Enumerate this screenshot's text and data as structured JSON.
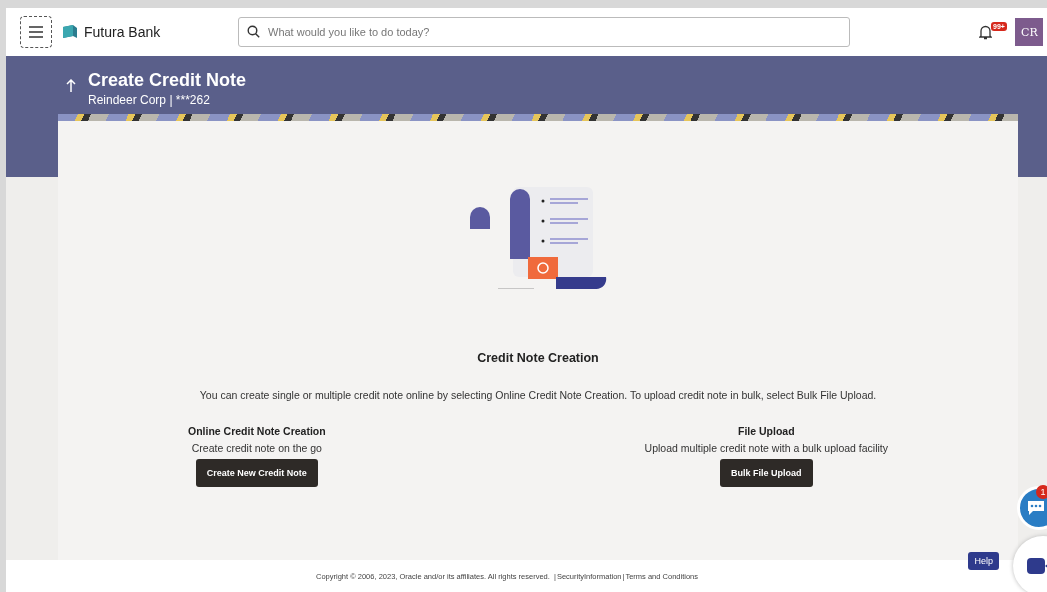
{
  "header": {
    "brand": "Futura Bank",
    "search": {
      "placeholder": "What would you like to do today?"
    },
    "notification_count": "99+",
    "avatar": "CR"
  },
  "banner": {
    "title": "Create Credit Note",
    "subtitle": "Reindeer Corp | ***262"
  },
  "content": {
    "heading": "Credit Note Creation",
    "description": "You can create single or multiple credit note online by selecting Online Credit Note Creation. To upload credit note in bulk, select Bulk File Upload.",
    "options": [
      {
        "title": "Online Credit Note Creation",
        "text": "Create credit note on the go",
        "button": "Create New Credit Note"
      },
      {
        "title": "File Upload",
        "text": "Upload multiple credit note with a bulk upload facility",
        "button": "Bulk File Upload"
      }
    ]
  },
  "footer": {
    "copyright": "Copyright © 2006, 2023, Oracle and/or its affiliates. All rights reserved.",
    "separators": [
      "|",
      "|"
    ],
    "links": [
      "SecurityInformation",
      "Terms and Conditions"
    ]
  },
  "chat_badge": "1",
  "help": "Help"
}
